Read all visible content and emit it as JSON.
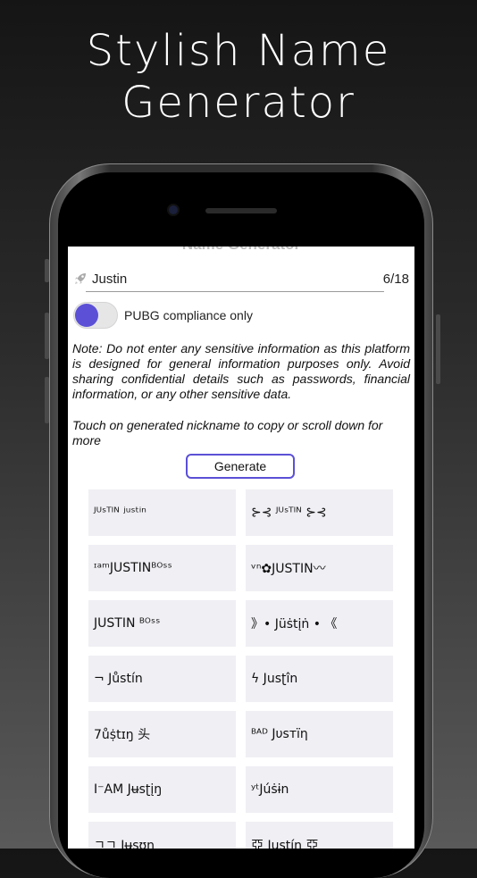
{
  "headline": {
    "line1": "Stylish Name",
    "line2": "Generator"
  },
  "screen": {
    "title": "Name Generator",
    "input_value": "Justin",
    "char_counter": "6/18",
    "toggle_label": "PUBG compliance only",
    "toggle_on": true,
    "note": "Note: Do not enter any sensitive information as this platform is designed for general information purposes only. Avoid sharing confidential details such as passwords, financial information, or any other sensitive data.",
    "hint": "Touch on generated nickname to copy or scroll down for more",
    "generate_label": "Generate"
  },
  "nicknames": [
    "ᴶᵁˢᵀᴵᴺ ʲᵘˢᵗⁱⁿ",
    "⊱⊰ ᴶᵁˢᵀᴵᴺ ⊱⊰",
    "ᶦᵃᵐJUSTINᴮᴼˢˢ",
    "ᵛⁿ✿JUSTIN〰",
    "JUSTIN ᴮᴼˢˢ",
    "》• Jüṡtįṅ • 《",
    "¬ Jůstín",
    "ϟ Jusʈîn",
    "7ůṩtɪŋ 头",
    "ᴮᴬᴰ Jυѕтïη",
    "I⁻AM Jʉѕʈįŋ",
    "ʸᵗJúṡɨn",
    "ㄱㄱ Jʉsʊn",
    "亞 Justín 亞"
  ],
  "colors": {
    "accent": "#5b50d6",
    "cell_bg": "#efeff4"
  }
}
